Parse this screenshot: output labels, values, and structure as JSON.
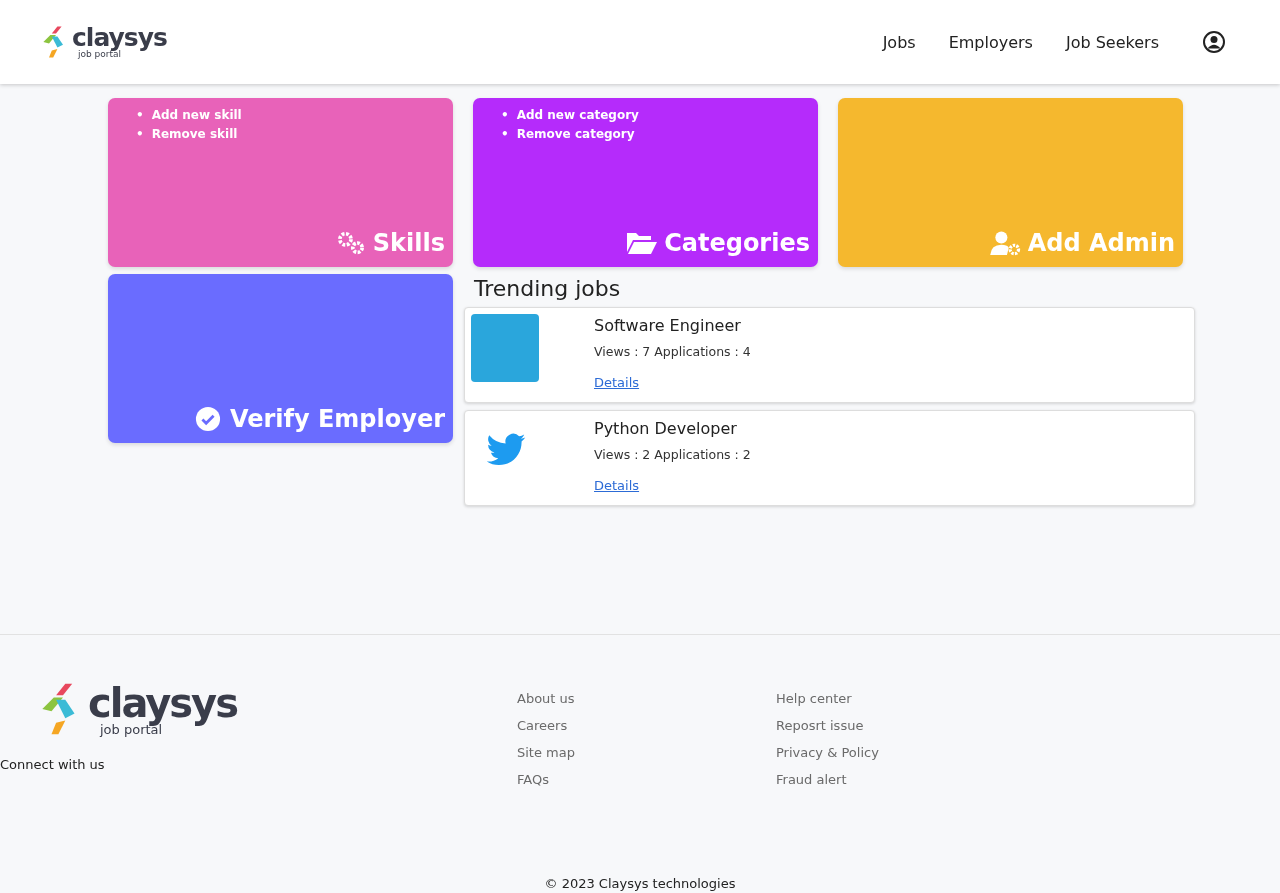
{
  "header": {
    "logo": {
      "name": "claysys",
      "tagline": "job portal"
    },
    "nav": [
      "Jobs",
      "Employers",
      "Job Seekers"
    ]
  },
  "cards": [
    {
      "title": "Skills",
      "kind": "gears",
      "color": "#e862b9",
      "items": [
        {
          "bullet": "•",
          "label": "Add new skill"
        },
        {
          "bullet": "•",
          "label": "Remove skill"
        }
      ]
    },
    {
      "title": "Categories",
      "kind": "folder",
      "color": "#b52bfb",
      "items": [
        {
          "bullet": "•",
          "label": "Add new category"
        },
        {
          "bullet": "•",
          "label": "Remove category"
        }
      ]
    },
    {
      "title": "Add Admin",
      "kind": "usergear",
      "color": "#f5b82e"
    },
    {
      "title": "Verify Employer",
      "kind": "check",
      "color": "#6a6cff"
    }
  ],
  "trending": {
    "title": "Trending jobs",
    "jobs": [
      {
        "title": "Software Engineer",
        "stats": "Views : 7 Applications : 4",
        "link": "Details",
        "kind": "photo"
      },
      {
        "title": "Python Developer",
        "stats": "Views : 2 Applications : 2",
        "link": "Details",
        "kind": "logo"
      }
    ]
  },
  "footer": {
    "logo": {
      "name": "claysys",
      "tagline": "job portal"
    },
    "connect": "Connect with us",
    "links_1": [
      "About us",
      "Careers",
      "Site map",
      "FAQs"
    ],
    "links_2": [
      "Help center",
      "Reposrt issue",
      "Privacy & Policy",
      "Fraud alert"
    ],
    "copyright": "© 2023 Claysys technologies"
  }
}
